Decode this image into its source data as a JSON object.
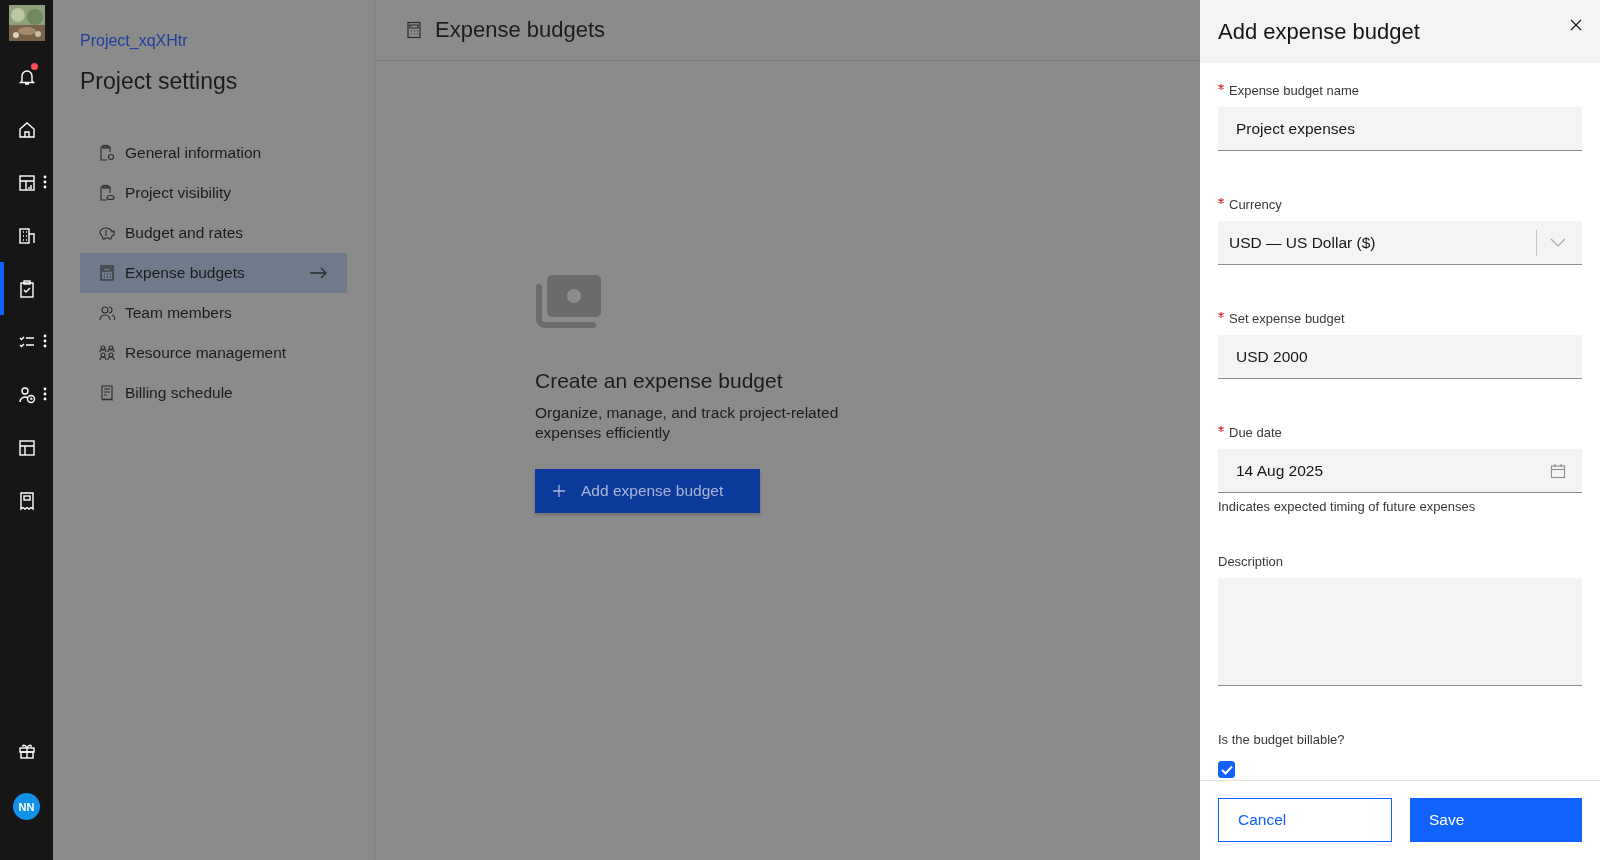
{
  "rail": {
    "items": [
      {
        "selected": false,
        "has_menu": false,
        "badge": true
      },
      {
        "selected": false,
        "has_menu": false,
        "badge": false
      },
      {
        "selected": false,
        "has_menu": true,
        "badge": false
      },
      {
        "selected": false,
        "has_menu": false,
        "badge": false
      },
      {
        "selected": true,
        "has_menu": false,
        "badge": false
      },
      {
        "selected": false,
        "has_menu": true,
        "badge": false
      },
      {
        "selected": false,
        "has_menu": true,
        "badge": false
      },
      {
        "selected": false,
        "has_menu": false,
        "badge": false
      },
      {
        "selected": false,
        "has_menu": false,
        "badge": false
      }
    ],
    "bottom_items": [
      {
        "selected": false
      }
    ],
    "avatar": "NN"
  },
  "settings": {
    "breadcrumb": "Project_xqXHtr",
    "title": "Project settings",
    "items": [
      {
        "label": "General information",
        "selected": false
      },
      {
        "label": "Project visibility",
        "selected": false
      },
      {
        "label": "Budget and rates",
        "selected": false
      },
      {
        "label": "Expense budgets",
        "selected": true
      },
      {
        "label": "Team members",
        "selected": false
      },
      {
        "label": "Resource management",
        "selected": false
      },
      {
        "label": "Billing schedule",
        "selected": false
      }
    ]
  },
  "main": {
    "title": "Expense budgets",
    "empty_state": {
      "title": "Create an expense budget",
      "description": "Organize, manage, and track project-related expenses efficiently",
      "button": "Add expense budget"
    }
  },
  "panel": {
    "title": "Add expense budget",
    "fields": [
      {
        "kind": "text",
        "label": "Expense budget name",
        "required": true,
        "value": "Project expenses"
      },
      {
        "kind": "select",
        "label": "Currency",
        "required": true,
        "value": "USD — US Dollar ($)"
      },
      {
        "kind": "text",
        "label": "Set expense budget",
        "required": true,
        "value": "USD 2000"
      },
      {
        "kind": "date",
        "label": "Due date",
        "required": true,
        "value": "14 Aug 2025",
        "helper": "Indicates expected timing of future expenses"
      },
      {
        "kind": "textarea",
        "label": "Description",
        "required": false
      }
    ],
    "checkbox": {
      "label": "Is the budget billable?",
      "checked": true
    },
    "buttons": [
      {
        "kind": "secondary",
        "label": "Cancel"
      },
      {
        "kind": "primary",
        "label": "Save"
      }
    ]
  }
}
